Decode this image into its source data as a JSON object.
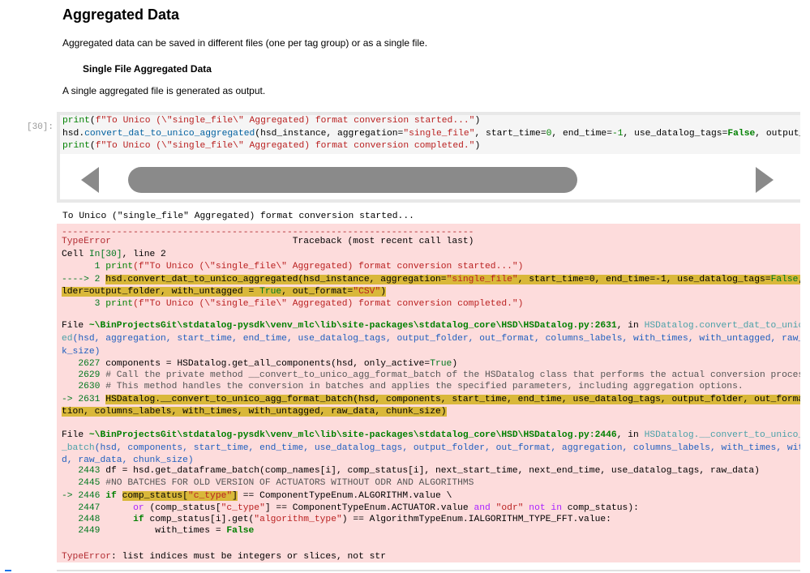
{
  "heading": "Aggregated Data",
  "intro": "Aggregated data can be saved in different files (one per tag group) or as a single file.",
  "subheading": "Single File Aggregated Data",
  "desc": "A single aggregated file is generated as output.",
  "prompt": "[30]:",
  "code_lines": [
    [
      [
        "print",
        "pr"
      ],
      [
        "(",
        ""
      ],
      [
        "f\"To Unico (\\\"single_file\\\" Aggregated) format conversion started...\"",
        "str"
      ],
      [
        ")",
        ""
      ]
    ],
    [
      [
        "hsd.",
        ""
      ],
      [
        "convert_dat_to_unico_aggregated",
        "fn"
      ],
      [
        "(hsd_instance, aggregation=",
        ""
      ],
      [
        "\"single_file\"",
        "str"
      ],
      [
        ", start_time=",
        ""
      ],
      [
        "0",
        "num"
      ],
      [
        ", end_time=",
        ""
      ],
      [
        "-1",
        "num"
      ],
      [
        ", use_datalog_tags=",
        ""
      ],
      [
        "False",
        "bgrn"
      ],
      [
        ", output_folder=output_folder, with_untagged = True, out_format=\"CSV\")",
        ""
      ]
    ],
    [
      [
        "print",
        "pr"
      ],
      [
        "(",
        ""
      ],
      [
        "f\"To Unico (\\\"single_file\\\" Aggregated) format conversion completed.\"",
        "str"
      ],
      [
        ")",
        ""
      ]
    ]
  ],
  "stdout": "To Unico (\"single_file\" Aggregated) format conversion started...",
  "traceback": [
    {
      "t": 287,
      "s": [
        [
          "---------------------------------------------------------------------------",
          "red"
        ]
      ]
    },
    {
      "t": 298,
      "s": [
        [
          "TypeError",
          "red"
        ],
        [
          "                                 Traceback (most recent call last)",
          ""
        ]
      ]
    },
    {
      "t": 314,
      "s": [
        [
          "Cell ",
          ""
        ],
        [
          "In[30]",
          "grn"
        ],
        [
          ", line 2",
          ""
        ]
      ]
    },
    {
      "t": 329,
      "s": [
        [
          "      1 ",
          "grn"
        ],
        [
          "print",
          "pr"
        ],
        [
          "(f\"To Unico (\\\"single_file\\\" Aggregated) format conversion started...\")",
          "str"
        ]
      ]
    },
    {
      "t": 345,
      "s": [
        [
          "----> 2 ",
          "grn"
        ],
        [
          "hsd.convert_dat_to_unico_aggregated(hsd_instance, aggregation=",
          "hl"
        ],
        [
          "\"single_file\"",
          "hl str"
        ],
        [
          ", start_time=0, end_time=-1, use_datalog_tags=",
          "hl"
        ],
        [
          "False",
          "hl grn"
        ],
        [
          ", output_fo",
          "hl"
        ]
      ]
    },
    {
      "t": 360,
      "s": [
        [
          "lder=output_folder, with_untagged = ",
          "hl"
        ],
        [
          "True",
          "hl grn"
        ],
        [
          ", out_format=",
          "hl"
        ],
        [
          "\"CSV\"",
          "hl str"
        ],
        [
          ")",
          "hl"
        ]
      ]
    },
    {
      "t": 375,
      "s": [
        [
          "      3 ",
          "grn"
        ],
        [
          "print",
          "pr"
        ],
        [
          "(f\"To Unico (\\\"single_file\\\" Aggregated) format conversion completed.\")",
          "str"
        ]
      ]
    },
    {
      "t": 402,
      "s": [
        [
          "File ",
          ""
        ],
        [
          "~\\BinProjectsGit\\stdatalog-pysdk\\venv_mlc\\lib\\site-packages\\stdatalog_core\\HSD\\HSDatalog.py:2631",
          "bgrn"
        ],
        [
          ", in ",
          ""
        ],
        [
          "HSDatalog.convert_dat_to_unico_aggregat",
          "teal"
        ]
      ]
    },
    {
      "t": 418,
      "s": [
        [
          "ed",
          "teal"
        ],
        [
          "(hsd, aggregation, start_time, end_time, use_datalog_tags, output_folder, out_format, columns_labels, with_times, with_untagged, raw_data, chun",
          "blue"
        ]
      ]
    },
    {
      "t": 434,
      "s": [
        [
          "k_size)",
          "blue"
        ]
      ]
    },
    {
      "t": 449,
      "s": [
        [
          "   2627 ",
          "grn"
        ],
        [
          "components = HSDatalog.get_all_components(hsd, only_active=",
          ""
        ],
        [
          "True",
          "grn"
        ],
        [
          ")",
          ""
        ]
      ]
    },
    {
      "t": 463,
      "s": [
        [
          "   2629 ",
          "grn"
        ],
        [
          "# Call the private method __convert_to_unico_agg_format_batch of the HSDatalog class that performs the actual conversion process.",
          "cm"
        ]
      ]
    },
    {
      "t": 477,
      "s": [
        [
          "   2630 ",
          "grn"
        ],
        [
          "# This method handles the conversion in batches and applies the specified parameters, including aggregation options.",
          "cm"
        ]
      ]
    },
    {
      "t": 493,
      "s": [
        [
          "-> 2631 ",
          "grn"
        ],
        [
          "HSDatalog.__convert_to_unico_agg_format_batch(hsd, components, start_time, end_time, use_datalog_tags, output_folder, out_format, aggrega",
          "hl"
        ]
      ]
    },
    {
      "t": 508,
      "s": [
        [
          "tion, columns_labels, with_times, with_untagged, raw_data, chunk_size)",
          "hl"
        ]
      ]
    },
    {
      "t": 537,
      "s": [
        [
          "File ",
          ""
        ],
        [
          "~\\BinProjectsGit\\stdatalog-pysdk\\venv_mlc\\lib\\site-packages\\stdatalog_core\\HSD\\HSDatalog.py:2446",
          "bgrn"
        ],
        [
          ", in ",
          ""
        ],
        [
          "HSDatalog.__convert_to_unico_agg_format",
          "teal"
        ]
      ]
    },
    {
      "t": 553,
      "s": [
        [
          "_batch",
          "teal"
        ],
        [
          "(hsd, components, start_time, end_time, use_datalog_tags, output_folder, out_format, aggregation, columns_labels, with_times, with_untagge",
          "blue"
        ]
      ]
    },
    {
      "t": 568,
      "s": [
        [
          "d, raw_data, chunk_size)",
          "blue"
        ]
      ]
    },
    {
      "t": 581,
      "s": [
        [
          "   2443 ",
          "grn"
        ],
        [
          "df = hsd.get_dataframe_batch(comp_names[i], comp_status[i], next_start_time, next_end_time, use_datalog_tags, raw_data)",
          ""
        ]
      ]
    },
    {
      "t": 596,
      "s": [
        [
          "   2445 ",
          "grn"
        ],
        [
          "#NO BATCHES FOR OLD VERSION OF ACTUATORS WITHOUT ODR AND ALGORITHMS",
          "cm"
        ]
      ]
    },
    {
      "t": 612,
      "s": [
        [
          "-> 2446 ",
          "grn"
        ],
        [
          "if ",
          "bgrn"
        ],
        [
          "comp_status[",
          "hl"
        ],
        [
          "\"c_type\"",
          "hl str"
        ],
        [
          "]",
          "hl"
        ],
        [
          " == ComponentTypeEnum.ALGORITHM.value \\",
          ""
        ]
      ]
    },
    {
      "t": 627,
      "s": [
        [
          "   2447 ",
          "grn"
        ],
        [
          "     ",
          ""
        ],
        [
          "or",
          "sp"
        ],
        [
          " (comp_status[",
          ""
        ],
        [
          "\"c_type\"",
          "str"
        ],
        [
          "] == ComponentTypeEnum.ACTUATOR.value ",
          ""
        ],
        [
          "and",
          "sp"
        ],
        [
          " ",
          ""
        ],
        [
          "\"odr\"",
          "str"
        ],
        [
          " ",
          ""
        ],
        [
          "not in",
          "sp"
        ],
        [
          " comp_status):",
          ""
        ]
      ]
    },
    {
      "t": 641,
      "s": [
        [
          "   2448 ",
          "grn"
        ],
        [
          "     ",
          ""
        ],
        [
          "if",
          "bgrn"
        ],
        [
          " comp_status[i].get(",
          ""
        ],
        [
          "\"algorithm_type\"",
          "str"
        ],
        [
          ") == AlgorithmTypeEnum.IALGORITHM_TYPE_FFT.value:",
          ""
        ]
      ]
    },
    {
      "t": 655,
      "s": [
        [
          "   2449 ",
          "grn"
        ],
        [
          "         with_times = ",
          ""
        ],
        [
          "False",
          "bgrn"
        ]
      ]
    },
    {
      "t": 687,
      "s": [
        [
          "TypeError",
          "red"
        ],
        [
          ": list indices must be integers or slices, not str",
          ""
        ]
      ]
    }
  ]
}
